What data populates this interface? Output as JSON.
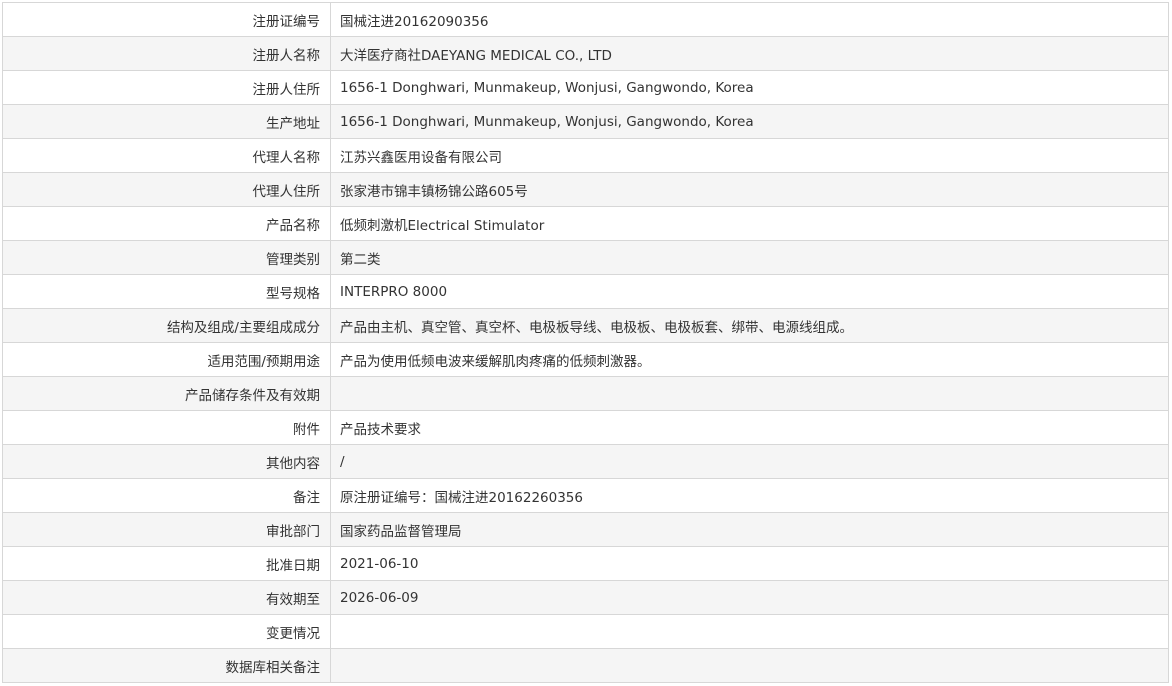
{
  "rows": [
    {
      "label": "注册证编号",
      "value": "国械注进20162090356"
    },
    {
      "label": "注册人名称",
      "value": "大洋医疗商社DAEYANG MEDICAL CO., LTD"
    },
    {
      "label": "注册人住所",
      "value": "1656-1 Donghwari, Munmakeup, Wonjusi, Gangwondo, Korea"
    },
    {
      "label": "生产地址",
      "value": "1656-1 Donghwari, Munmakeup, Wonjusi, Gangwondo, Korea"
    },
    {
      "label": "代理人名称",
      "value": "江苏兴鑫医用设备有限公司"
    },
    {
      "label": "代理人住所",
      "value": "张家港市锦丰镇杨锦公路605号"
    },
    {
      "label": "产品名称",
      "value": "低频刺激机Electrical Stimulator"
    },
    {
      "label": "管理类别",
      "value": "第二类"
    },
    {
      "label": "型号规格",
      "value": "INTERPRO 8000"
    },
    {
      "label": "结构及组成/主要组成成分",
      "value": "产品由主机、真空管、真空杯、电极板导线、电极板、电极板套、绑带、电源线组成。"
    },
    {
      "label": "适用范围/预期用途",
      "value": "产品为使用低频电波来缓解肌肉疼痛的低频刺激器。"
    },
    {
      "label": "产品储存条件及有效期",
      "value": ""
    },
    {
      "label": "附件",
      "value": "产品技术要求"
    },
    {
      "label": "其他内容",
      "value": "/"
    },
    {
      "label": "备注",
      "value": "原注册证编号：国械注进20162260356"
    },
    {
      "label": "审批部门",
      "value": "国家药品监督管理局"
    },
    {
      "label": "批准日期",
      "value": "2021-06-10"
    },
    {
      "label": "有效期至",
      "value": "2026-06-09"
    },
    {
      "label": "变更情况",
      "value": ""
    },
    {
      "label": "数据库相关备注",
      "value": ""
    }
  ]
}
